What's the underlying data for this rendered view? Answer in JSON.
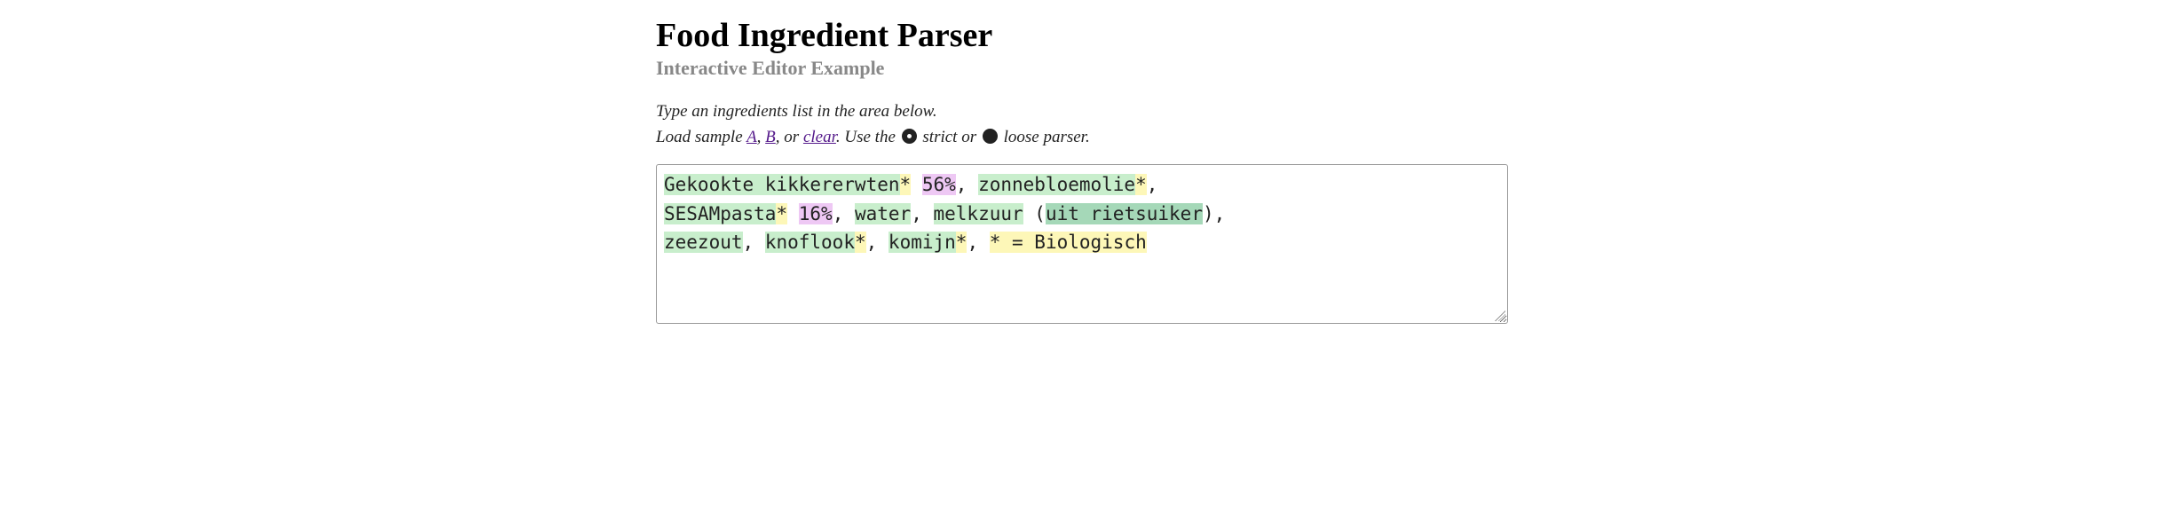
{
  "header": {
    "title": "Food Ingredient Parser",
    "subtitle": "Interactive Editor Example"
  },
  "instructions": {
    "line1": "Type an ingredients list in the area below.",
    "load_sample_prefix": "Load sample ",
    "sample_a": "A",
    "sep1": ", ",
    "sample_b": "B",
    "sep2": ", or ",
    "clear": "clear",
    "after_clear": ". Use the ",
    "strict_label": " strict or ",
    "loose_label": " loose parser."
  },
  "parser": {
    "mode": "loose",
    "strict_selected": false,
    "loose_selected": true
  },
  "editor": {
    "tokens": [
      {
        "text": "Gekookte kikkererwten",
        "kind": "ing"
      },
      {
        "text": "*",
        "kind": "star"
      },
      {
        "text": " ",
        "kind": "plain"
      },
      {
        "text": "56%",
        "kind": "pct"
      },
      {
        "text": ", ",
        "kind": "plain"
      },
      {
        "text": "zonnebloemolie",
        "kind": "ing"
      },
      {
        "text": "*",
        "kind": "star"
      },
      {
        "text": ", ",
        "kind": "plain"
      },
      {
        "text": "\n",
        "kind": "plain"
      },
      {
        "text": "SESAMpasta",
        "kind": "ing"
      },
      {
        "text": "*",
        "kind": "star"
      },
      {
        "text": " ",
        "kind": "plain"
      },
      {
        "text": "16%",
        "kind": "pct"
      },
      {
        "text": ", ",
        "kind": "plain"
      },
      {
        "text": "water",
        "kind": "ing"
      },
      {
        "text": ", ",
        "kind": "plain"
      },
      {
        "text": "melkzuur",
        "kind": "ing"
      },
      {
        "text": " (",
        "kind": "plain"
      },
      {
        "text": "uit rietsuiker",
        "kind": "src"
      },
      {
        "text": "), ",
        "kind": "plain"
      },
      {
        "text": "\n",
        "kind": "plain"
      },
      {
        "text": "zeezout",
        "kind": "ing"
      },
      {
        "text": ", ",
        "kind": "plain"
      },
      {
        "text": "knoflook",
        "kind": "ing"
      },
      {
        "text": "*",
        "kind": "star"
      },
      {
        "text": ", ",
        "kind": "plain"
      },
      {
        "text": "komijn",
        "kind": "ing"
      },
      {
        "text": "*",
        "kind": "star"
      },
      {
        "text": ", ",
        "kind": "plain"
      },
      {
        "text": "* = Biologisch",
        "kind": "note"
      }
    ]
  },
  "colors": {
    "ingredient_bg": "#c8eecc",
    "mark_bg": "#fdf7b8",
    "percent_bg": "#eec8f4",
    "source_bg": "#a5d8b8",
    "note_bg": "#fdf7b8"
  }
}
